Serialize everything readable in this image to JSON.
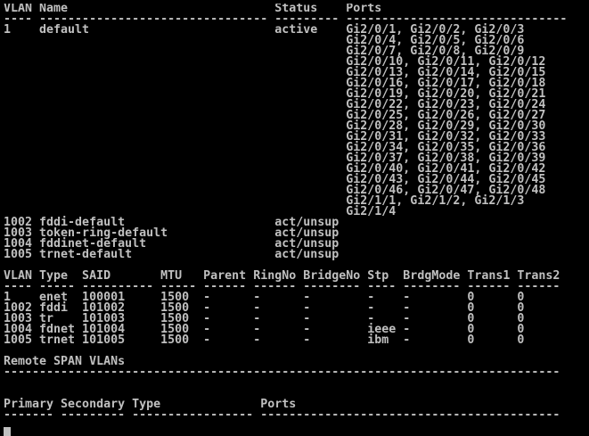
{
  "terminal": {
    "lines": [
      "VLAN Name                             Status    Ports",
      "---- -------------------------------- --------- -------------------------------",
      "1    default                          active    Gi2/0/1, Gi2/0/2, Gi2/0/3",
      "                                                Gi2/0/4, Gi2/0/5, Gi2/0/6",
      "                                                Gi2/0/7, Gi2/0/8, Gi2/0/9",
      "                                                Gi2/0/10, Gi2/0/11, Gi2/0/12",
      "                                                Gi2/0/13, Gi2/0/14, Gi2/0/15",
      "                                                Gi2/0/16, Gi2/0/17, Gi2/0/18",
      "                                                Gi2/0/19, Gi2/0/20, Gi2/0/21",
      "                                                Gi2/0/22, Gi2/0/23, Gi2/0/24",
      "                                                Gi2/0/25, Gi2/0/26, Gi2/0/27",
      "                                                Gi2/0/28, Gi2/0/29, Gi2/0/30",
      "                                                Gi2/0/31, Gi2/0/32, Gi2/0/33",
      "                                                Gi2/0/34, Gi2/0/35, Gi2/0/36",
      "                                                Gi2/0/37, Gi2/0/38, Gi2/0/39",
      "                                                Gi2/0/40, Gi2/0/41, Gi2/0/42",
      "                                                Gi2/0/43, Gi2/0/44, Gi2/0/45",
      "                                                Gi2/0/46, Gi2/0/47, Gi2/0/48",
      "                                                Gi2/1/1, Gi2/1/2, Gi2/1/3",
      "                                                Gi2/1/4",
      "1002 fddi-default                     act/unsup",
      "1003 token-ring-default               act/unsup",
      "1004 fddinet-default                  act/unsup",
      "1005 trnet-default                    act/unsup",
      "",
      "VLAN Type  SAID       MTU   Parent RingNo BridgeNo Stp  BrdgMode Trans1 Trans2",
      "---- ----- ---------- ----- ------ ------ -------- ---- -------- ------ ------",
      "1    enet  100001     1500  -      -      -        -    -        0      0",
      "1002 fddi  101002     1500  -      -      -        -    -        0      0",
      "1003 tr    101003     1500  -      -      -        -    -        0      0",
      "1004 fdnet 101004     1500  -      -      -        ieee -        0      0",
      "1005 trnet 101005     1500  -      -      -        ibm  -        0      0",
      "",
      "Remote SPAN VLANs",
      "------------------------------------------------------------------------------",
      "",
      "",
      "Primary Secondary Type              Ports",
      "------- --------- ----------------- ------------------------------------------",
      "",
      ""
    ]
  }
}
